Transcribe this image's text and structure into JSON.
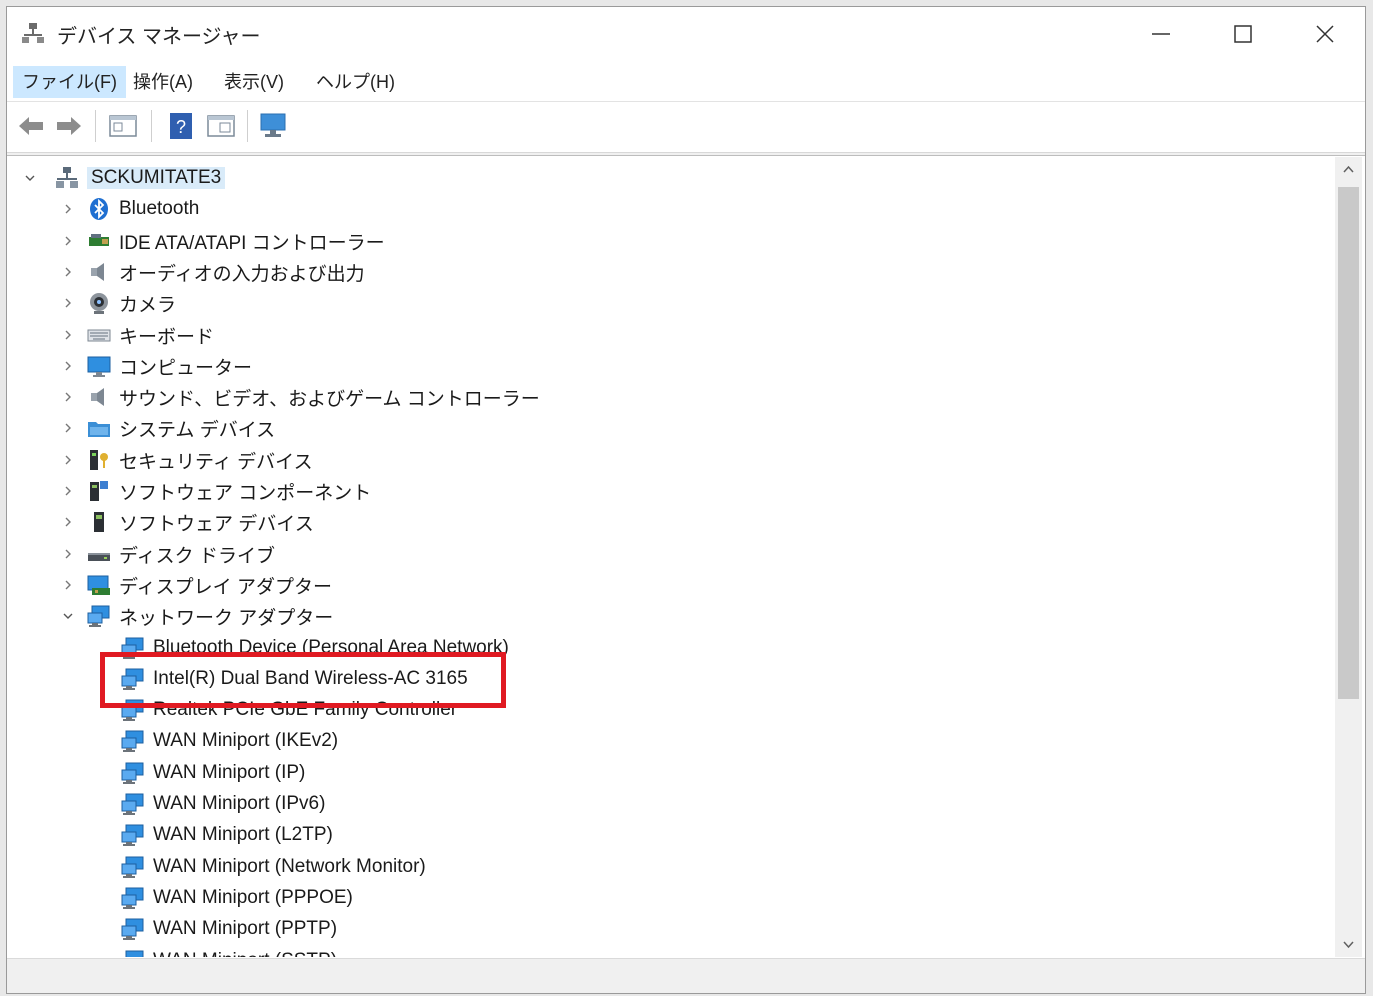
{
  "window": {
    "title": "デバイス マネージャー"
  },
  "caption_buttons": [
    "minimize-icon",
    "maximize-icon",
    "close-icon"
  ],
  "menu": [
    {
      "label": "ファイル(F)",
      "active": true
    },
    {
      "label": "操作(A)"
    },
    {
      "label": "表示(V)"
    },
    {
      "label": "ヘルプ(H)"
    }
  ],
  "toolbar": [
    "back-arrow-icon",
    "forward-arrow-icon",
    "properties-icon",
    "help-icon",
    "console-tree-icon",
    "scan-hardware-icon"
  ],
  "tree": {
    "root": {
      "label": "SCKUMITATE3",
      "expanded": true,
      "icon": "computer-node-icon"
    },
    "categories": [
      {
        "label": "Bluetooth",
        "icon": "bluetooth-icon"
      },
      {
        "label": "IDE ATA/ATAPI コントローラー",
        "icon": "ide-controller-icon"
      },
      {
        "label": "オーディオの入力および出力",
        "icon": "speaker-icon"
      },
      {
        "label": "カメラ",
        "icon": "camera-icon"
      },
      {
        "label": "キーボード",
        "icon": "keyboard-icon"
      },
      {
        "label": "コンピューター",
        "icon": "monitor-icon"
      },
      {
        "label": "サウンド、ビデオ、およびゲーム コントローラー",
        "icon": "speaker-icon"
      },
      {
        "label": "システム デバイス",
        "icon": "system-folder-icon"
      },
      {
        "label": "セキュリティ デバイス",
        "icon": "security-device-icon"
      },
      {
        "label": "ソフトウェア コンポーネント",
        "icon": "software-component-icon"
      },
      {
        "label": "ソフトウェア デバイス",
        "icon": "software-device-icon"
      },
      {
        "label": "ディスク ドライブ",
        "icon": "disk-drive-icon"
      },
      {
        "label": "ディスプレイ アダプター",
        "icon": "display-adapter-icon"
      },
      {
        "label": "ネットワーク アダプター",
        "icon": "network-adapter-icon",
        "expanded": true
      }
    ],
    "network_devices": [
      "Bluetooth Device (Personal Area Network)",
      "Intel(R) Dual Band Wireless-AC 3165",
      "Realtek PCIe GbE Family Controller",
      "WAN Miniport (IKEv2)",
      "WAN Miniport (IP)",
      "WAN Miniport (IPv6)",
      "WAN Miniport (L2TP)",
      "WAN Miniport (Network Monitor)",
      "WAN Miniport (PPPOE)",
      "WAN Miniport (PPTP)",
      "WAN Miniport (SSTP)"
    ],
    "highlighted_device": "Intel(R) Dual Band Wireless-AC 3165"
  },
  "colors": {
    "highlight": "#e01a22",
    "selection": "#d9ebf9",
    "menu_active": "#cce8ff"
  }
}
